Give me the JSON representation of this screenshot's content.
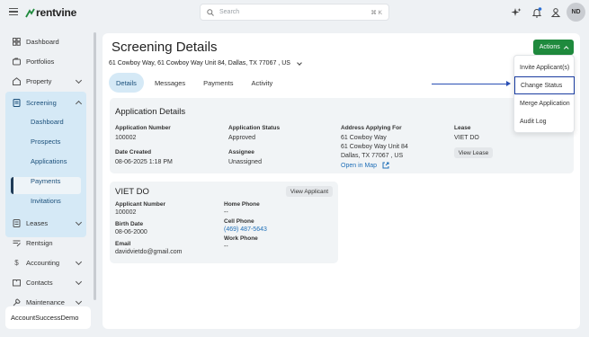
{
  "brand": "rentvine",
  "search": {
    "placeholder": "Search",
    "shortcut": "⌘ K"
  },
  "user_initials": "ND",
  "sidebar": {
    "items": [
      {
        "label": "Dashboard",
        "icon": "dashboard-icon"
      },
      {
        "label": "Portfolios",
        "icon": "portfolios-icon"
      },
      {
        "label": "Property",
        "icon": "property-icon"
      },
      {
        "label": "Screening",
        "icon": "screening-icon"
      },
      {
        "label": "Leases",
        "icon": "leases-icon"
      },
      {
        "label": "Rentsign",
        "icon": "rentsign-icon"
      },
      {
        "label": "Accounting",
        "icon": "dollar-icon"
      },
      {
        "label": "Contacts",
        "icon": "contacts-icon"
      },
      {
        "label": "Maintenance",
        "icon": "wrench-icon"
      }
    ],
    "screening_sub": [
      "Dashboard",
      "Prospects",
      "Applications",
      "Payments",
      "Invitations"
    ],
    "account": "AccountSuccessDemo"
  },
  "page": {
    "title": "Screening Details",
    "address": "61 Cowboy Way, 61 Cowboy Way Unit 84, Dallas, TX 77067 , US",
    "actions_label": "Actions",
    "tabs": [
      "Details",
      "Messages",
      "Payments",
      "Activity"
    ]
  },
  "application": {
    "title": "Application Details",
    "number_label": "Application Number",
    "number": "100002",
    "date_label": "Date Created",
    "date": "08-06-2025 1:18 PM",
    "status_label": "Application Status",
    "status": "Approved",
    "assignee_label": "Assignee",
    "assignee": "Unassigned",
    "address_label": "Address Applying For",
    "address_line1": "61 Cowboy Way",
    "address_line2": "61 Cowboy Way Unit 84",
    "address_line3": "Dallas, TX 77067 , US",
    "map_link": "Open in Map",
    "lease_label": "Lease",
    "lease": "VIET DO",
    "view_lease": "View Lease"
  },
  "applicant": {
    "name": "VIET DO",
    "view_button": "View Applicant",
    "number_label": "Applicant Number",
    "number": "100002",
    "birth_label": "Birth Date",
    "birth": "08-06-2000",
    "email_label": "Email",
    "email": "davidvietdo@gmail.com",
    "home_label": "Home Phone",
    "home": "--",
    "cell_label": "Cell Phone",
    "cell": "(469) 487-5643",
    "work_label": "Work Phone",
    "work": "--"
  },
  "actions_menu": [
    "Invite Applicant(s)",
    "Change Status",
    "Merge Application",
    "Audit Log"
  ],
  "colors": {
    "accent_green": "#1f8a3d",
    "active_blue": "#d5e9f6",
    "link": "#1f6fb8",
    "highlight_border": "#1a3ca0"
  }
}
